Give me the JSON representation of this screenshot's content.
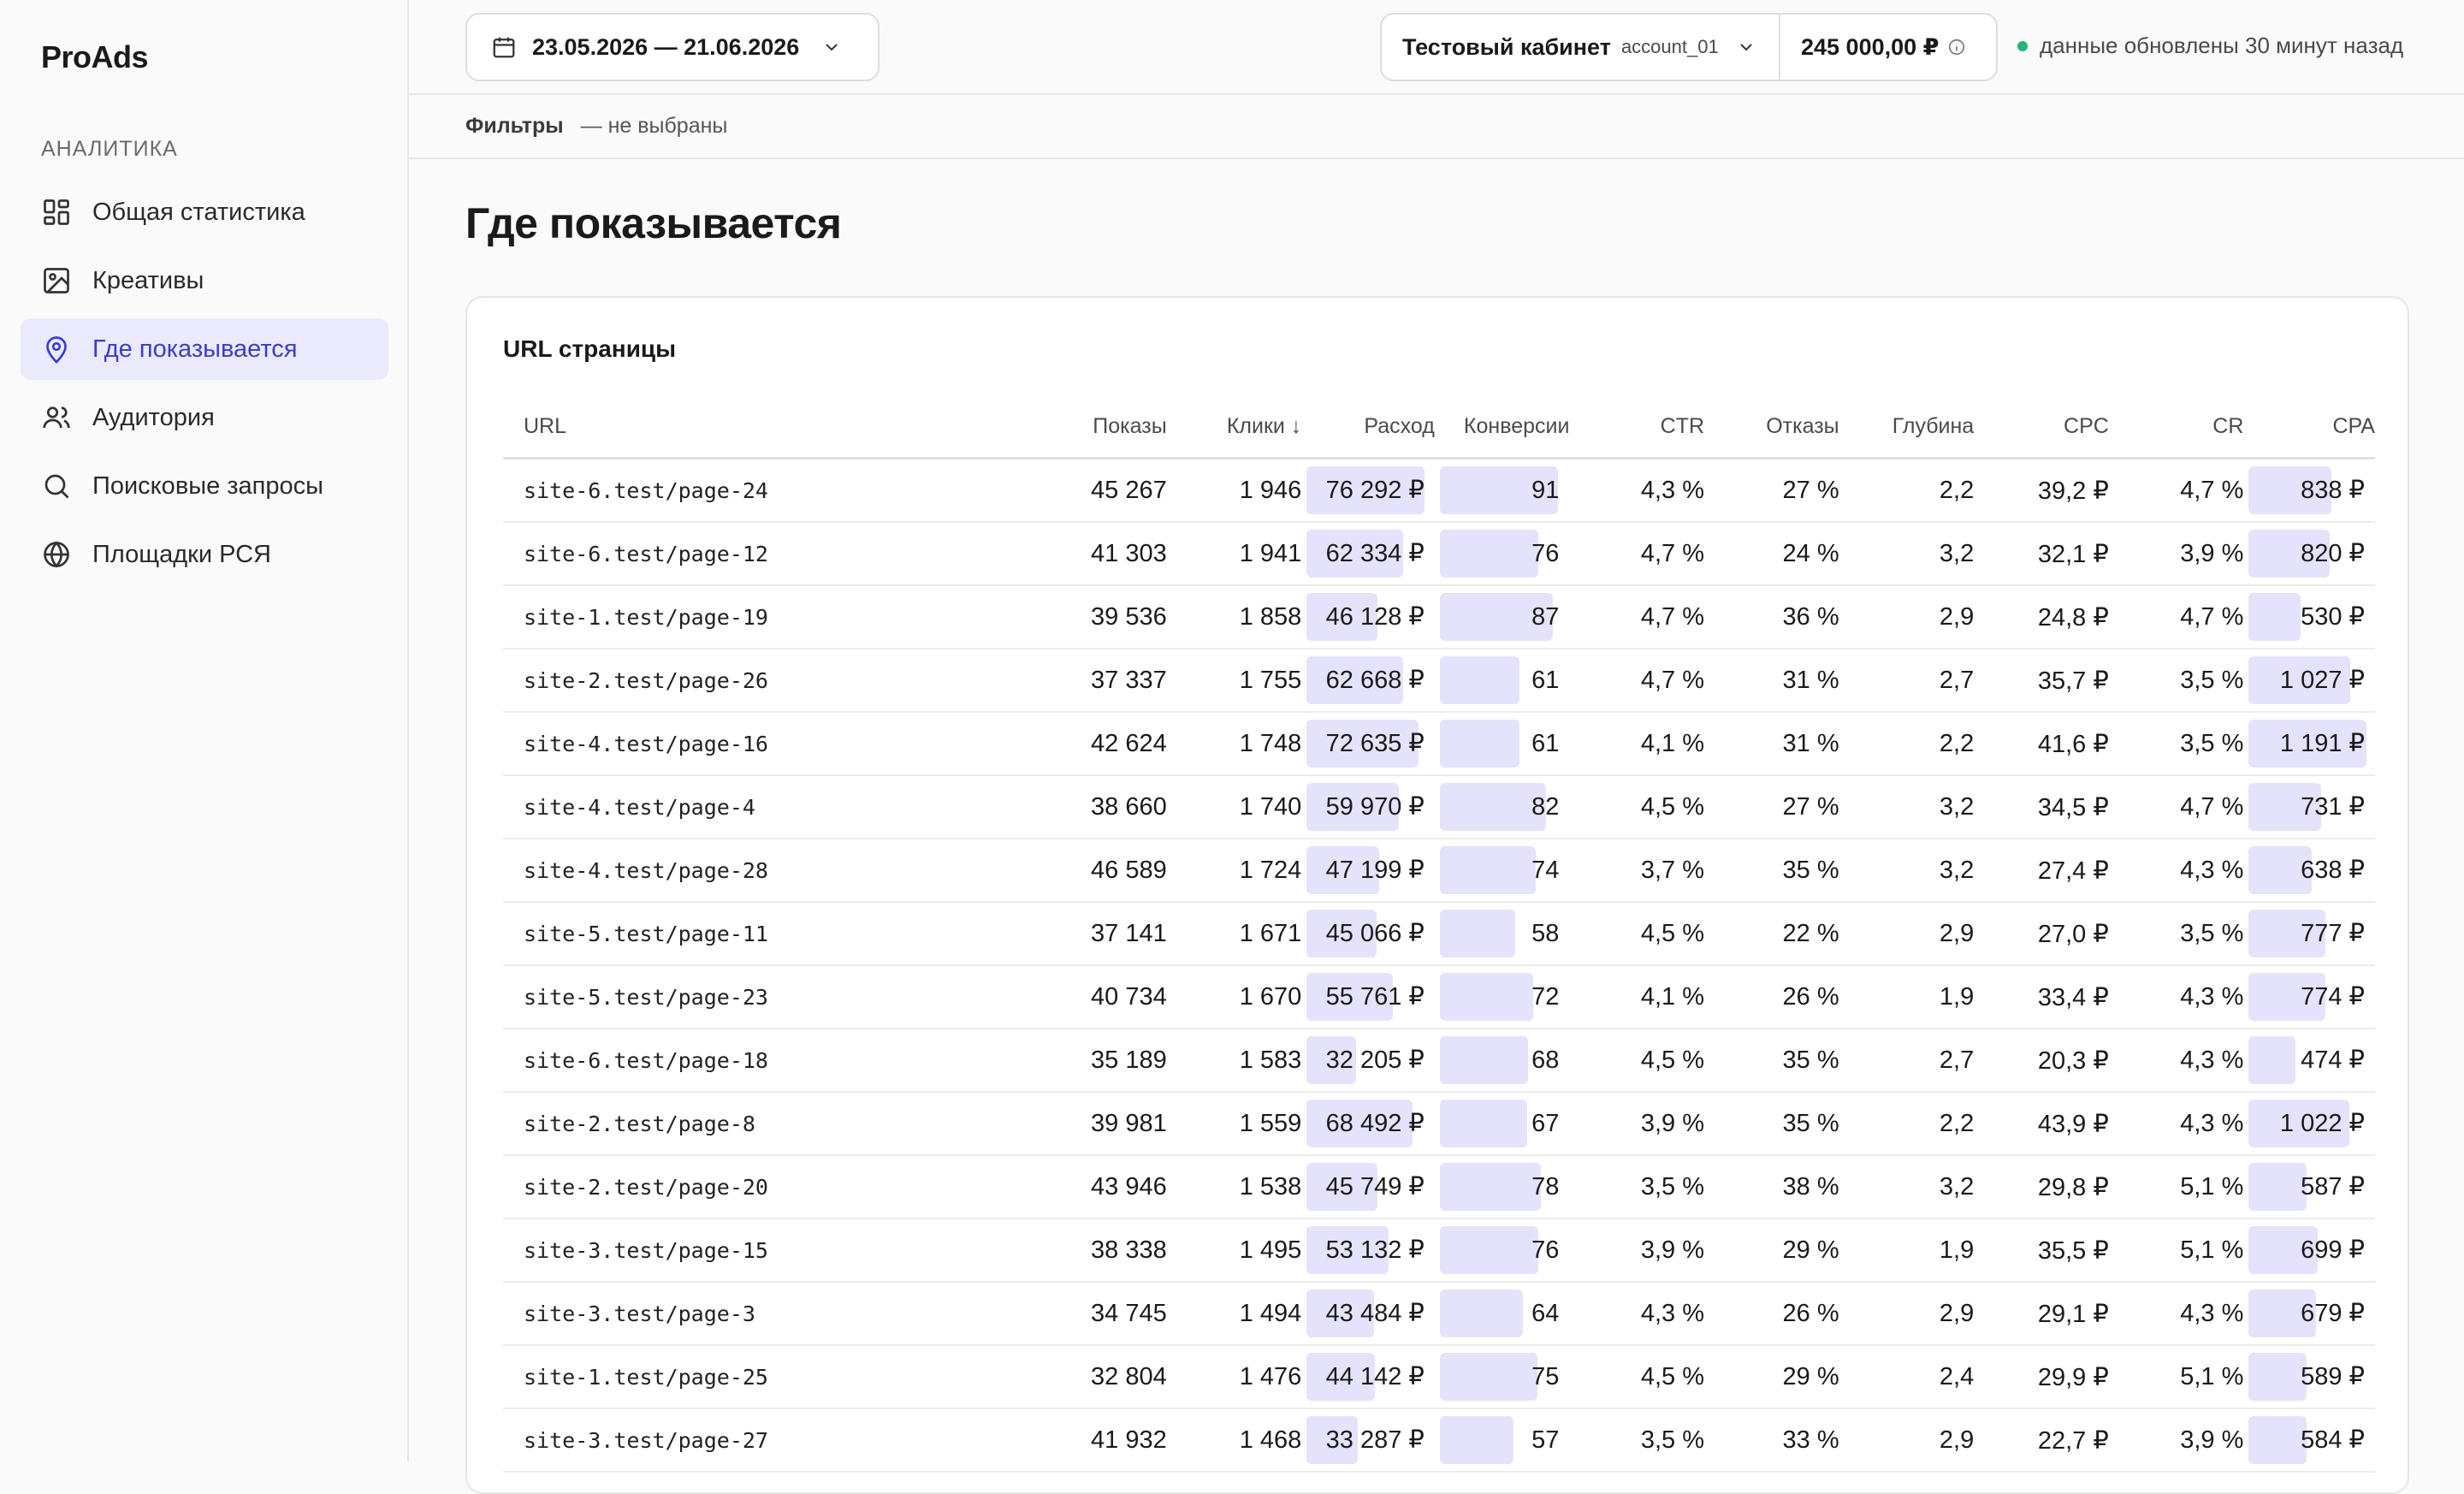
{
  "app": {
    "logo": "ProAds"
  },
  "sidebar": {
    "section_label": "АНАЛИТИКА",
    "items": [
      {
        "label": "Общая статистика",
        "icon": "dashboard-icon",
        "active": false
      },
      {
        "label": "Креативы",
        "icon": "image-icon",
        "active": false
      },
      {
        "label": "Где показывается",
        "icon": "location-pin-icon",
        "active": true
      },
      {
        "label": "Аудитория",
        "icon": "users-icon",
        "active": false
      },
      {
        "label": "Поисковые запросы",
        "icon": "search-icon",
        "active": false
      },
      {
        "label": "Площадки РСЯ",
        "icon": "globe-icon",
        "active": false
      }
    ]
  },
  "header": {
    "date_range": "23.05.2026 — 21.06.2026",
    "account_name": "Тестовый кабинет",
    "account_id": "account_01",
    "balance": "245 000,00 ₽",
    "status_text": "данные обновлены 30 минут назад",
    "status_color": "#22b573"
  },
  "filters": {
    "label": "Фильтры",
    "value": "— не выбраны"
  },
  "page": {
    "title": "Где показывается"
  },
  "table": {
    "title": "URL страницы",
    "columns": [
      "URL",
      "Показы",
      "Клики ↓",
      "Расход",
      "Конверсии",
      "CTR",
      "Отказы",
      "Глубина",
      "CPC",
      "CR",
      "CPA"
    ],
    "bar_color": "#e4e3fb",
    "rows": [
      {
        "url": "site-6.test/page-24",
        "shows": "45 267",
        "clicks": "1 946",
        "spend": "76 292 ₽",
        "spend_value": 76292,
        "conv": "91",
        "conv_value": 91,
        "ctr": "4,3 %",
        "bounce": "27 %",
        "depth": "2,2",
        "cpc": "39,2 ₽",
        "cr": "4,7 %",
        "cpa": "838 ₽",
        "cpa_value": 838
      },
      {
        "url": "site-6.test/page-12",
        "shows": "41 303",
        "clicks": "1 941",
        "spend": "62 334 ₽",
        "spend_value": 62334,
        "conv": "76",
        "conv_value": 76,
        "ctr": "4,7 %",
        "bounce": "24 %",
        "depth": "3,2",
        "cpc": "32,1 ₽",
        "cr": "3,9 %",
        "cpa": "820 ₽",
        "cpa_value": 820
      },
      {
        "url": "site-1.test/page-19",
        "shows": "39 536",
        "clicks": "1 858",
        "spend": "46 128 ₽",
        "spend_value": 46128,
        "conv": "87",
        "conv_value": 87,
        "ctr": "4,7 %",
        "bounce": "36 %",
        "depth": "2,9",
        "cpc": "24,8 ₽",
        "cr": "4,7 %",
        "cpa": "530 ₽",
        "cpa_value": 530
      },
      {
        "url": "site-2.test/page-26",
        "shows": "37 337",
        "clicks": "1 755",
        "spend": "62 668 ₽",
        "spend_value": 62668,
        "conv": "61",
        "conv_value": 61,
        "ctr": "4,7 %",
        "bounce": "31 %",
        "depth": "2,7",
        "cpc": "35,7 ₽",
        "cr": "3,5 %",
        "cpa": "1 027 ₽",
        "cpa_value": 1027
      },
      {
        "url": "site-4.test/page-16",
        "shows": "42 624",
        "clicks": "1 748",
        "spend": "72 635 ₽",
        "spend_value": 72635,
        "conv": "61",
        "conv_value": 61,
        "ctr": "4,1 %",
        "bounce": "31 %",
        "depth": "2,2",
        "cpc": "41,6 ₽",
        "cr": "3,5 %",
        "cpa": "1 191 ₽",
        "cpa_value": 1191
      },
      {
        "url": "site-4.test/page-4",
        "shows": "38 660",
        "clicks": "1 740",
        "spend": "59 970 ₽",
        "spend_value": 59970,
        "conv": "82",
        "conv_value": 82,
        "ctr": "4,5 %",
        "bounce": "27 %",
        "depth": "3,2",
        "cpc": "34,5 ₽",
        "cr": "4,7 %",
        "cpa": "731 ₽",
        "cpa_value": 731
      },
      {
        "url": "site-4.test/page-28",
        "shows": "46 589",
        "clicks": "1 724",
        "spend": "47 199 ₽",
        "spend_value": 47199,
        "conv": "74",
        "conv_value": 74,
        "ctr": "3,7 %",
        "bounce": "35 %",
        "depth": "3,2",
        "cpc": "27,4 ₽",
        "cr": "4,3 %",
        "cpa": "638 ₽",
        "cpa_value": 638
      },
      {
        "url": "site-5.test/page-11",
        "shows": "37 141",
        "clicks": "1 671",
        "spend": "45 066 ₽",
        "spend_value": 45066,
        "conv": "58",
        "conv_value": 58,
        "ctr": "4,5 %",
        "bounce": "22 %",
        "depth": "2,9",
        "cpc": "27,0 ₽",
        "cr": "3,5 %",
        "cpa": "777 ₽",
        "cpa_value": 777
      },
      {
        "url": "site-5.test/page-23",
        "shows": "40 734",
        "clicks": "1 670",
        "spend": "55 761 ₽",
        "spend_value": 55761,
        "conv": "72",
        "conv_value": 72,
        "ctr": "4,1 %",
        "bounce": "26 %",
        "depth": "1,9",
        "cpc": "33,4 ₽",
        "cr": "4,3 %",
        "cpa": "774 ₽",
        "cpa_value": 774
      },
      {
        "url": "site-6.test/page-18",
        "shows": "35 189",
        "clicks": "1 583",
        "spend": "32 205 ₽",
        "spend_value": 32205,
        "conv": "68",
        "conv_value": 68,
        "ctr": "4,5 %",
        "bounce": "35 %",
        "depth": "2,7",
        "cpc": "20,3 ₽",
        "cr": "4,3 %",
        "cpa": "474 ₽",
        "cpa_value": 474
      },
      {
        "url": "site-2.test/page-8",
        "shows": "39 981",
        "clicks": "1 559",
        "spend": "68 492 ₽",
        "spend_value": 68492,
        "conv": "67",
        "conv_value": 67,
        "ctr": "3,9 %",
        "bounce": "35 %",
        "depth": "2,2",
        "cpc": "43,9 ₽",
        "cr": "4,3 %",
        "cpa": "1 022 ₽",
        "cpa_value": 1022
      },
      {
        "url": "site-2.test/page-20",
        "shows": "43 946",
        "clicks": "1 538",
        "spend": "45 749 ₽",
        "spend_value": 45749,
        "conv": "78",
        "conv_value": 78,
        "ctr": "3,5 %",
        "bounce": "38 %",
        "depth": "3,2",
        "cpc": "29,8 ₽",
        "cr": "5,1 %",
        "cpa": "587 ₽",
        "cpa_value": 587
      },
      {
        "url": "site-3.test/page-15",
        "shows": "38 338",
        "clicks": "1 495",
        "spend": "53 132 ₽",
        "spend_value": 53132,
        "conv": "76",
        "conv_value": 76,
        "ctr": "3,9 %",
        "bounce": "29 %",
        "depth": "1,9",
        "cpc": "35,5 ₽",
        "cr": "5,1 %",
        "cpa": "699 ₽",
        "cpa_value": 699
      },
      {
        "url": "site-3.test/page-3",
        "shows": "34 745",
        "clicks": "1 494",
        "spend": "43 484 ₽",
        "spend_value": 43484,
        "conv": "64",
        "conv_value": 64,
        "ctr": "4,3 %",
        "bounce": "26 %",
        "depth": "2,9",
        "cpc": "29,1 ₽",
        "cr": "4,3 %",
        "cpa": "679 ₽",
        "cpa_value": 679
      },
      {
        "url": "site-1.test/page-25",
        "shows": "32 804",
        "clicks": "1 476",
        "spend": "44 142 ₽",
        "spend_value": 44142,
        "conv": "75",
        "conv_value": 75,
        "ctr": "4,5 %",
        "bounce": "29 %",
        "depth": "2,4",
        "cpc": "29,9 ₽",
        "cr": "5,1 %",
        "cpa": "589 ₽",
        "cpa_value": 589
      },
      {
        "url": "site-3.test/page-27",
        "shows": "41 932",
        "clicks": "1 468",
        "spend": "33 287 ₽",
        "spend_value": 33287,
        "conv": "57",
        "conv_value": 57,
        "ctr": "3,5 %",
        "bounce": "33 %",
        "depth": "2,9",
        "cpc": "22,7 ₽",
        "cr": "3,9 %",
        "cpa": "584 ₽",
        "cpa_value": 584
      }
    ]
  }
}
